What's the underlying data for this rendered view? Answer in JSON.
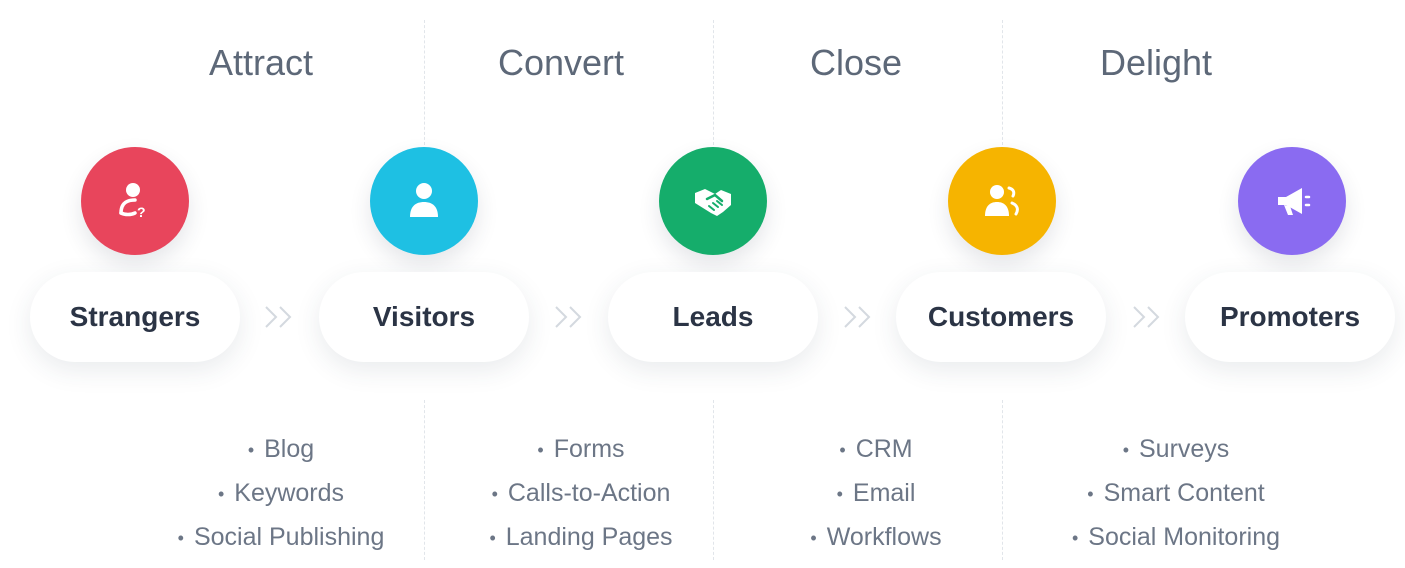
{
  "stages": [
    {
      "title": "Attract",
      "tools": [
        "Blog",
        "Keywords",
        "Social Publishing"
      ]
    },
    {
      "title": "Convert",
      "tools": [
        "Forms",
        "Calls-to-Action",
        "Landing Pages"
      ]
    },
    {
      "title": "Close",
      "tools": [
        "CRM",
        "Email",
        "Workflows"
      ]
    },
    {
      "title": "Delight",
      "tools": [
        "Surveys",
        "Smart Content",
        "Social Monitoring"
      ]
    }
  ],
  "personas": [
    {
      "label": "Strangers",
      "icon": "person-question-icon",
      "color": "#e8455c"
    },
    {
      "label": "Visitors",
      "icon": "person-icon",
      "color": "#1ec0e3"
    },
    {
      "label": "Leads",
      "icon": "handshake-icon",
      "color": "#15ad6b"
    },
    {
      "label": "Customers",
      "icon": "people-icon",
      "color": "#f6b400"
    },
    {
      "label": "Promoters",
      "icon": "megaphone-icon",
      "color": "#8a6bf1"
    }
  ]
}
